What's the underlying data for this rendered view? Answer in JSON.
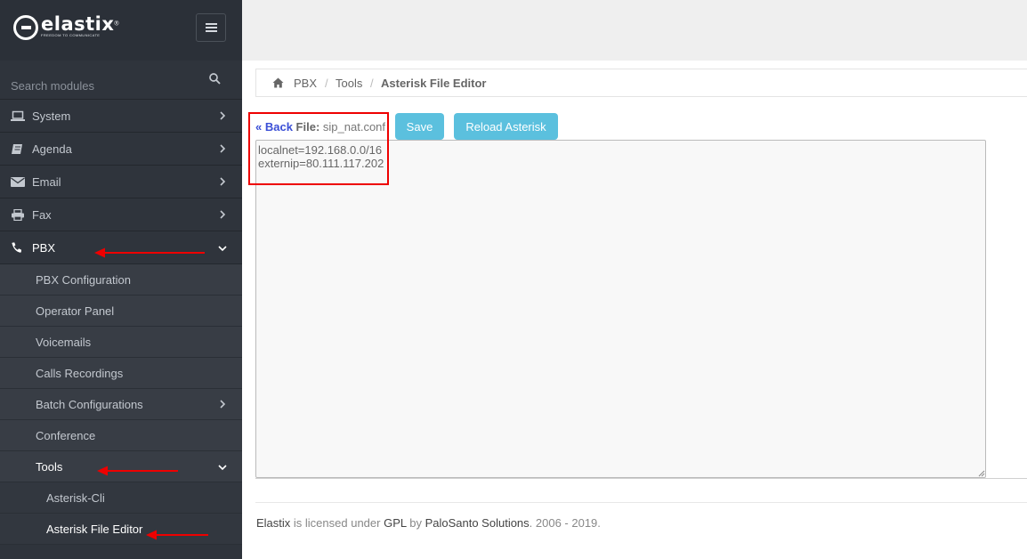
{
  "brand": {
    "name": "elastix",
    "tagline": "FREEDOM TO COMMUNICATE",
    "reg": "®"
  },
  "search": {
    "placeholder": "Search modules"
  },
  "nav": [
    {
      "label": "System",
      "icon": "laptop-icon"
    },
    {
      "label": "Agenda",
      "icon": "book-icon"
    },
    {
      "label": "Email",
      "icon": "envelope-icon"
    },
    {
      "label": "Fax",
      "icon": "printer-icon"
    },
    {
      "label": "PBX",
      "icon": "phone-icon"
    }
  ],
  "pbx_sub": [
    "PBX Configuration",
    "Operator Panel",
    "Voicemails",
    "Calls Recordings",
    "Batch Configurations",
    "Conference",
    "Tools"
  ],
  "tools_sub": [
    "Asterisk-Cli",
    "Asterisk File Editor"
  ],
  "breadcrumb": {
    "level1": "PBX",
    "level2": "Tools",
    "current": "Asterisk File Editor",
    "sep": "/"
  },
  "editor": {
    "back_label": "« Back",
    "file_label": "File:",
    "file_name": "sip_nat.conf",
    "save_label": "Save",
    "reload_label": "Reload Asterisk",
    "lines": [
      "localnet=192.168.0.0/16",
      "externip=80.111.117.202"
    ]
  },
  "footer": {
    "product": "Elastix",
    "t1": " is licensed under ",
    "license": "GPL",
    "t2": " by ",
    "company": "PaloSanto Solutions",
    "t3": ". 2006 - 2019."
  },
  "colors": {
    "sidebar": "#2f343c",
    "accent_button": "#5bc0de",
    "link": "#3b4fd6",
    "annotation": "#e00000"
  }
}
